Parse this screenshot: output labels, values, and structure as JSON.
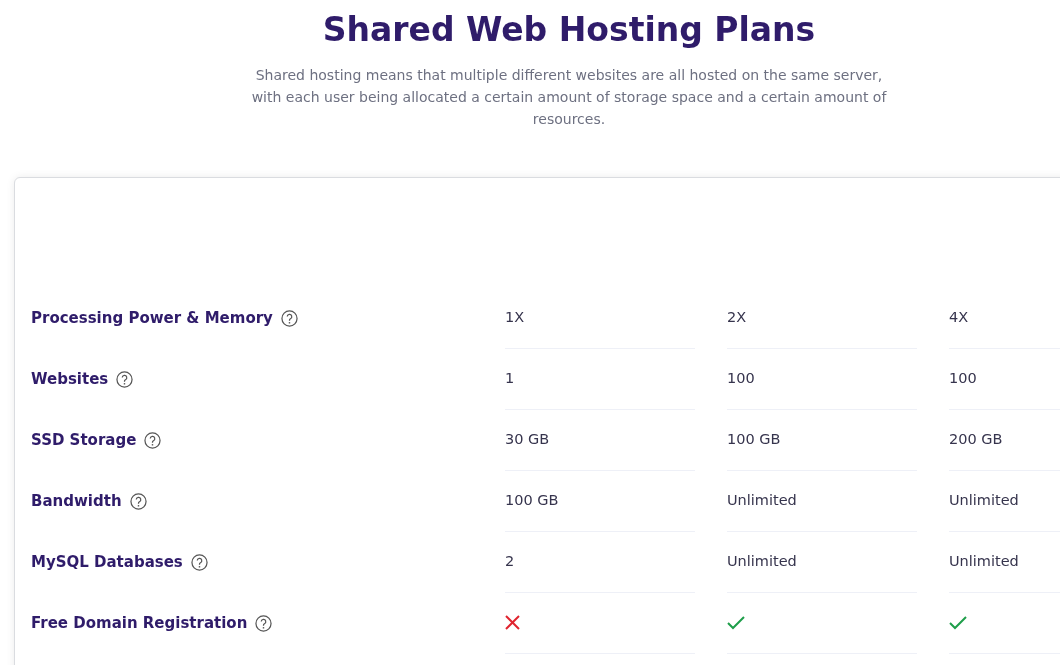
{
  "heading": "Shared Web Hosting Plans",
  "intro": "Shared hosting means that multiple different websites are all hosted on the same server, with each user being allocated a certain amount of storage space and a certain amount of resources.",
  "features": [
    {
      "label": "Processing Power & Memory",
      "cells": [
        {
          "kind": "text",
          "text": "1X"
        },
        {
          "kind": "text",
          "text": "2X"
        },
        {
          "kind": "text",
          "text": "4X"
        }
      ]
    },
    {
      "label": "Websites",
      "cells": [
        {
          "kind": "text",
          "text": "1"
        },
        {
          "kind": "text",
          "text": "100"
        },
        {
          "kind": "text",
          "text": "100"
        }
      ]
    },
    {
      "label": "SSD Storage",
      "cells": [
        {
          "kind": "text",
          "text": "30 GB"
        },
        {
          "kind": "text",
          "text": "100 GB"
        },
        {
          "kind": "text",
          "text": "200 GB"
        }
      ]
    },
    {
      "label": "Bandwidth",
      "cells": [
        {
          "kind": "text",
          "text": "100 GB"
        },
        {
          "kind": "text",
          "text": "Unlimited"
        },
        {
          "kind": "text",
          "text": "Unlimited"
        }
      ]
    },
    {
      "label": "MySQL Databases",
      "cells": [
        {
          "kind": "text",
          "text": "2"
        },
        {
          "kind": "text",
          "text": "Unlimited"
        },
        {
          "kind": "text",
          "text": "Unlimited"
        }
      ]
    },
    {
      "label": "Free Domain Registration",
      "cells": [
        {
          "kind": "mark",
          "included": false
        },
        {
          "kind": "mark",
          "included": true
        },
        {
          "kind": "mark",
          "included": true
        }
      ]
    }
  ]
}
